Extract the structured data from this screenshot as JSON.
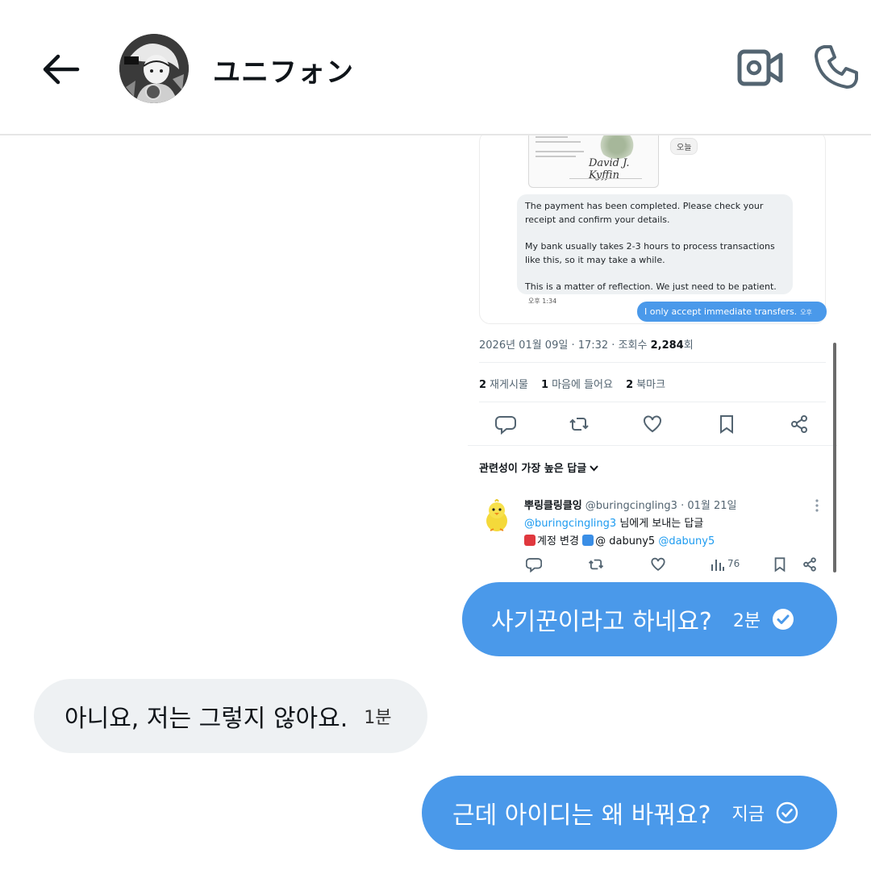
{
  "header": {
    "contact_name": "ユニフォン",
    "back_icon": "back-arrow-icon",
    "video_icon": "video-camera-icon",
    "call_icon": "phone-icon"
  },
  "shared_post": {
    "inner_card": {
      "today_chip": "오늘",
      "signature": "David J. Kyffin",
      "incoming_message": {
        "p1": "The payment has been completed. Please check your receipt and confirm your details.",
        "p2": "My bank usually takes 2-3 hours to process transactions like this, so it may take a while.",
        "p3": "This is a matter of reflection. We just need to be patient.",
        "time": "오후 1:34"
      },
      "outgoing_message": {
        "text": "I only accept immediate transfers.",
        "time": "오후 1:36"
      }
    },
    "meta": {
      "date": "2026년 01월 09일 · 17:32 · 조회수",
      "views": "2,284",
      "views_suffix": "회"
    },
    "stats": {
      "reposts_count": "2",
      "reposts_label": "재게시물",
      "likes_count": "1",
      "likes_label": "마음에 들어요",
      "bookmarks_count": "2",
      "bookmarks_label": "북마크"
    },
    "section_title": "관련성이 가장 높은 답글",
    "reply": {
      "name": "뿌링클링클잉",
      "handle": "@buringcingling3 · 01월 21일",
      "reply_to_handle": "@buringcingling3",
      "reply_to_suffix": "님에게 보내는 답글",
      "line3_text": "계정 변경",
      "line3_mid": "@ dabuny5",
      "line3_link": "@dabuny5",
      "views": "76"
    }
  },
  "messages": [
    {
      "direction": "out",
      "text": "사기꾼이라고 하네요?",
      "time": "2분",
      "status": "read"
    },
    {
      "direction": "in",
      "text": "아니요, 저는 그렇지 않아요.",
      "time": "1분"
    },
    {
      "direction": "out",
      "text": "근데 아이디는 왜 바꿔요?",
      "time": "지금",
      "status": "sent"
    }
  ],
  "colors": {
    "outgoing_bubble": "#4a99ea",
    "incoming_bubble": "#eef1f3",
    "link": "#1d9bf0"
  }
}
